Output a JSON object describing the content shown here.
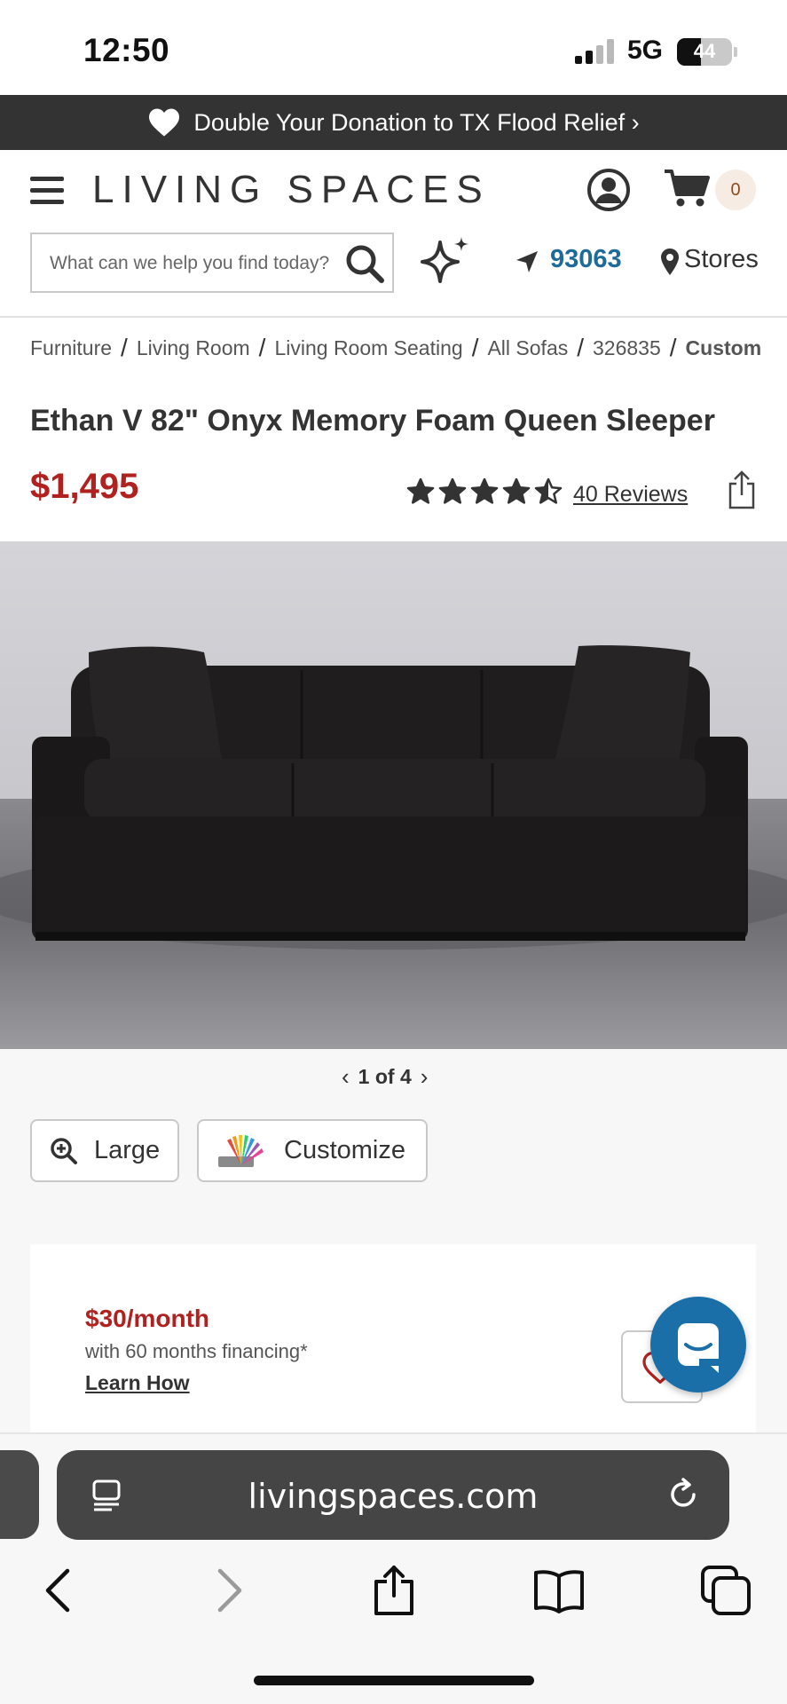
{
  "status_bar": {
    "time": "12:50",
    "network": "5G",
    "battery": "44",
    "battery_level": 0.44
  },
  "promo": {
    "text": "Double Your Donation to TX Flood Relief ›",
    "icon": "heart-icon"
  },
  "header": {
    "logo": "LIVING SPACES",
    "cart_count": "0"
  },
  "search": {
    "placeholder": "What can we help you find today?"
  },
  "location": {
    "zip": "93063",
    "stores_label": "Stores"
  },
  "breadcrumb": [
    "Furniture",
    "Living Room",
    "Living Room Seating",
    "All Sofas",
    "326835",
    "Custom"
  ],
  "product": {
    "title": "Ethan V 82\" Onyx Memory Foam Queen Sleeper",
    "price": "$1,495",
    "rating": 4.5,
    "rating_max": 5,
    "reviews_label": "40 Reviews"
  },
  "gallery": {
    "current": "1",
    "total": "4",
    "pager_label": "1 of 4"
  },
  "buttons": {
    "large_label": "Large",
    "customize_label": "Customize"
  },
  "financing": {
    "monthly": "$30/month",
    "terms": "with 60 months financing*",
    "link": "Learn How"
  },
  "browser": {
    "url": "livingspaces.com"
  },
  "colors": {
    "brand_red": "#b0211f",
    "link_blue": "#1e6a99",
    "promo_bg": "#333333",
    "chat_blue": "#1a6fa8"
  }
}
